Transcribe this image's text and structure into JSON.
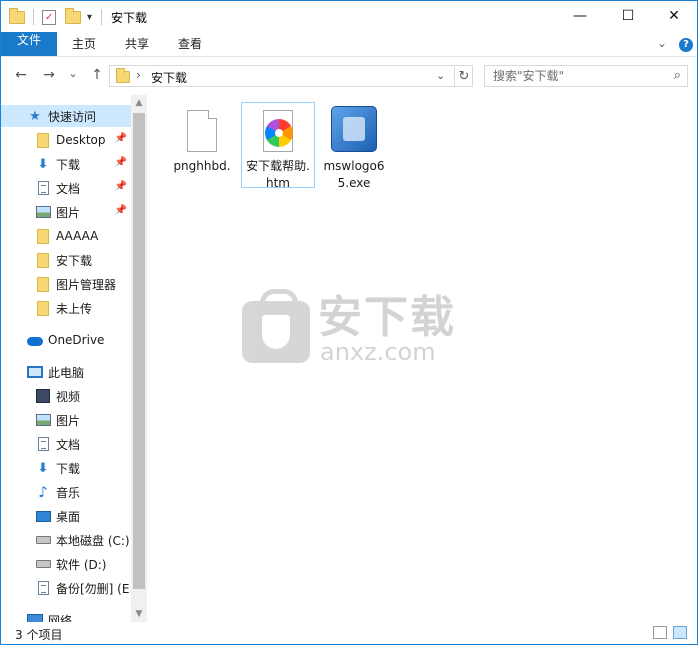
{
  "window": {
    "title": "安下载",
    "controls": {
      "minimize": "—",
      "maximize": "☐",
      "close": "✕"
    }
  },
  "quick_access_toolbar": {
    "dropdown": "▾"
  },
  "ribbon": {
    "tabs": [
      {
        "label": "文件"
      },
      {
        "label": "主页"
      },
      {
        "label": "共享"
      },
      {
        "label": "查看"
      }
    ],
    "collapse": "⌄",
    "help": "?"
  },
  "navigation": {
    "back": "←",
    "forward": "→",
    "recent": "⌄",
    "up": "↑",
    "address_crumb": "安下载",
    "address_separator": "›",
    "address_dropdown": "⌄",
    "refresh": "↻",
    "search_placeholder": "搜索\"安下载\"",
    "search_icon": "⌕"
  },
  "sidebar": {
    "items": [
      {
        "label": "快速访问",
        "icon": "star-icon"
      },
      {
        "label": "Desktop",
        "icon": "folder-icon",
        "pinned": true
      },
      {
        "label": "下载",
        "icon": "download-icon",
        "pinned": true
      },
      {
        "label": "文档",
        "icon": "document-icon",
        "pinned": true
      },
      {
        "label": "图片",
        "icon": "picture-icon",
        "pinned": true
      },
      {
        "label": "AAAAA",
        "icon": "folder-icon"
      },
      {
        "label": "安下载",
        "icon": "folder-icon"
      },
      {
        "label": "图片管理器",
        "icon": "folder-icon"
      },
      {
        "label": "未上传",
        "icon": "folder-icon"
      },
      {
        "label": "OneDrive",
        "icon": "cloud-icon"
      },
      {
        "label": "此电脑",
        "icon": "computer-icon"
      },
      {
        "label": "视频",
        "icon": "video-icon"
      },
      {
        "label": "图片",
        "icon": "picture-icon"
      },
      {
        "label": "文档",
        "icon": "document-icon"
      },
      {
        "label": "下载",
        "icon": "download-icon"
      },
      {
        "label": "音乐",
        "icon": "music-icon"
      },
      {
        "label": "桌面",
        "icon": "desktop-icon"
      },
      {
        "label": "本地磁盘 (C:)",
        "icon": "drive-icon"
      },
      {
        "label": "软件 (D:)",
        "icon": "drive-icon"
      },
      {
        "label": "备份[勿删] (E:",
        "icon": "document-icon"
      },
      {
        "label": "网络",
        "icon": "network-icon"
      }
    ],
    "pin_glyph": "📌",
    "scroll_up": "▲",
    "scroll_down": "▼"
  },
  "files": [
    {
      "name": "pnghhbd.",
      "type": "blank-file"
    },
    {
      "name": "安下载帮助.htm",
      "type": "htm-file"
    },
    {
      "name": "mswlogo65.exe",
      "type": "exe-file"
    }
  ],
  "watermark": {
    "brand": "安下载",
    "domain": "anxz.com"
  },
  "status": {
    "item_count": "3 个项目"
  },
  "colors": {
    "accent": "#1979ca",
    "selection": "#cce8ff",
    "folder": "#f8d775"
  }
}
